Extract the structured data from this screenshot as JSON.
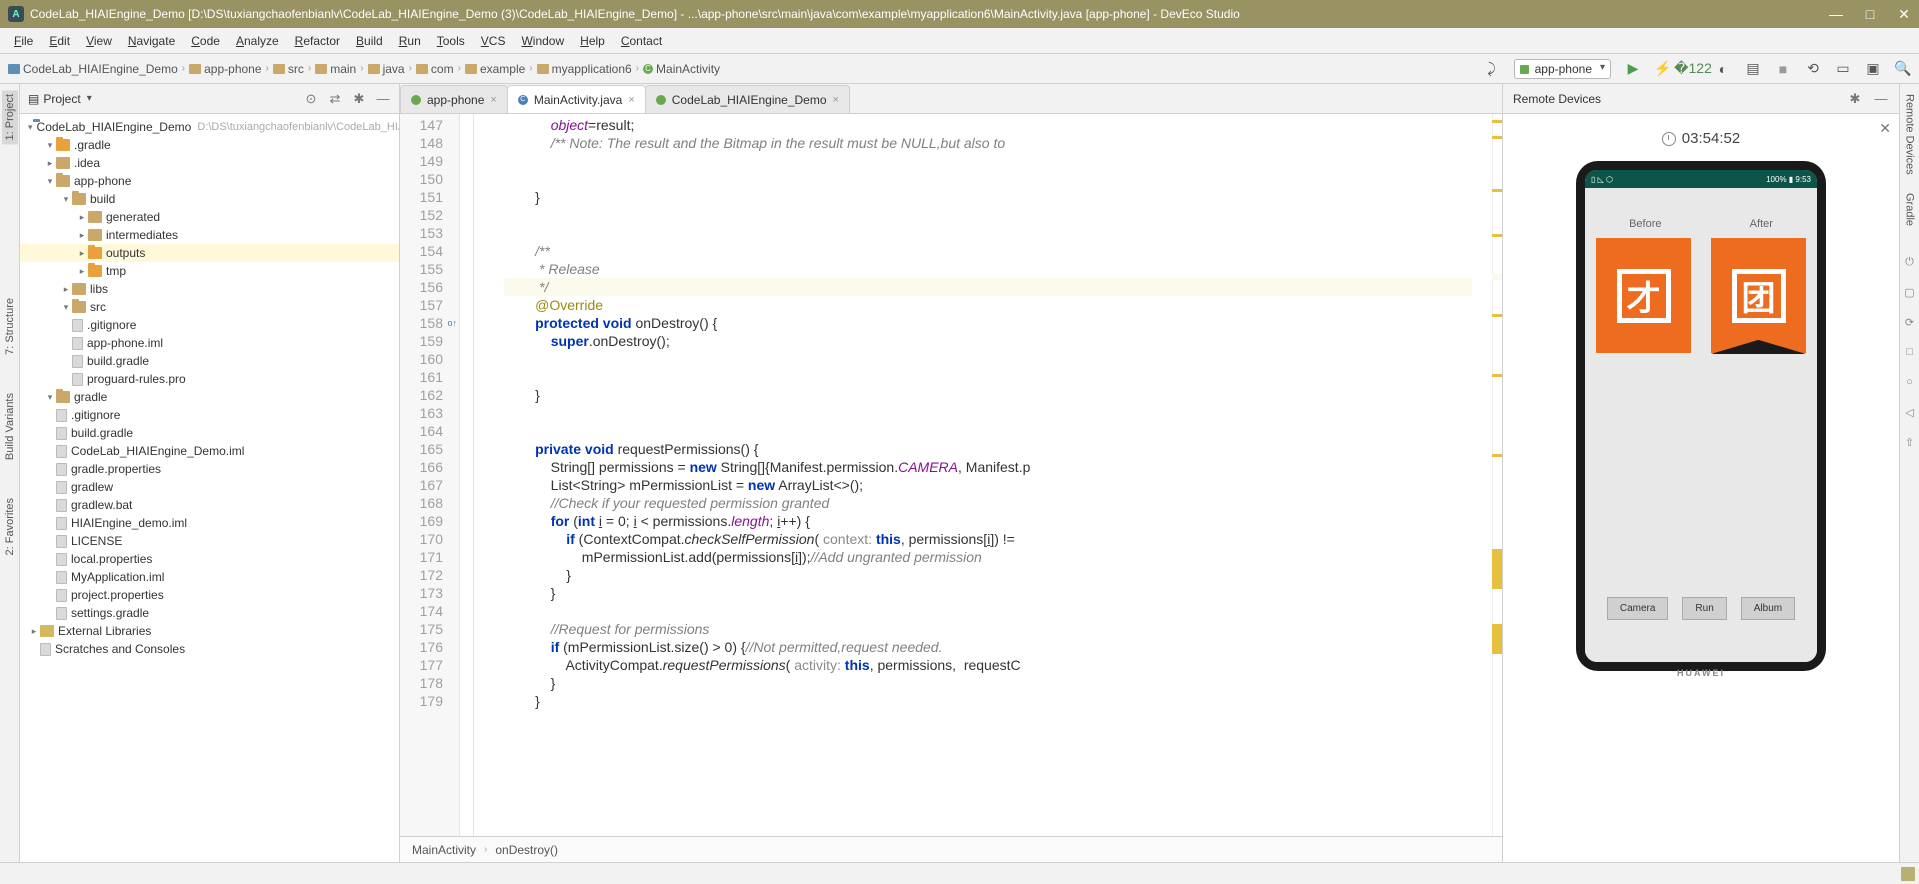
{
  "title": "CodeLab_HIAIEngine_Demo [D:\\DS\\tuxiangchaofenbianlv\\CodeLab_HIAIEngine_Demo (3)\\CodeLab_HIAIEngine_Demo] - ...\\app-phone\\src\\main\\java\\com\\example\\myapplication6\\MainActivity.java [app-phone] - DevEco Studio",
  "menu": [
    "File",
    "Edit",
    "View",
    "Navigate",
    "Code",
    "Analyze",
    "Refactor",
    "Build",
    "Run",
    "Tools",
    "VCS",
    "Window",
    "Help",
    "Contact"
  ],
  "breadcrumbs": [
    "CodeLab_HIAIEngine_Demo",
    "app-phone",
    "src",
    "main",
    "java",
    "com",
    "example",
    "myapplication6",
    "MainActivity"
  ],
  "run_config": "app-phone",
  "panel_title": "Project",
  "project": {
    "root": {
      "label": "CodeLab_HIAIEngine_Demo",
      "path": "D:\\DS\\tuxiangchaofenbianlv\\CodeLab_HIAIEr"
    },
    "items": [
      {
        "d": 1,
        "t": "folder",
        "open": true,
        "hi": true,
        "label": ".gradle"
      },
      {
        "d": 1,
        "t": "folder",
        "label": ".idea"
      },
      {
        "d": 1,
        "t": "folder",
        "open": true,
        "label": "app-phone"
      },
      {
        "d": 2,
        "t": "folder",
        "open": true,
        "label": "build"
      },
      {
        "d": 3,
        "t": "folder",
        "label": "generated"
      },
      {
        "d": 3,
        "t": "folder",
        "label": "intermediates"
      },
      {
        "d": 3,
        "t": "folder",
        "hi": true,
        "label": "outputs",
        "sel": true
      },
      {
        "d": 3,
        "t": "folder",
        "hi": true,
        "label": "tmp"
      },
      {
        "d": 2,
        "t": "folder",
        "label": "libs"
      },
      {
        "d": 2,
        "t": "folder",
        "open": true,
        "label": "src"
      },
      {
        "d": 2,
        "t": "file",
        "label": ".gitignore"
      },
      {
        "d": 2,
        "t": "file",
        "label": "app-phone.iml"
      },
      {
        "d": 2,
        "t": "file",
        "label": "build.gradle"
      },
      {
        "d": 2,
        "t": "file",
        "label": "proguard-rules.pro"
      },
      {
        "d": 1,
        "t": "folder",
        "open": true,
        "label": "gradle"
      },
      {
        "d": 1,
        "t": "file",
        "label": ".gitignore"
      },
      {
        "d": 1,
        "t": "file",
        "label": "build.gradle"
      },
      {
        "d": 1,
        "t": "file",
        "label": "CodeLab_HIAIEngine_Demo.iml"
      },
      {
        "d": 1,
        "t": "file",
        "label": "gradle.properties"
      },
      {
        "d": 1,
        "t": "file",
        "label": "gradlew"
      },
      {
        "d": 1,
        "t": "file",
        "label": "gradlew.bat"
      },
      {
        "d": 1,
        "t": "file",
        "label": "HIAIEngine_demo.iml"
      },
      {
        "d": 1,
        "t": "file",
        "label": "LICENSE"
      },
      {
        "d": 1,
        "t": "file",
        "label": "local.properties"
      },
      {
        "d": 1,
        "t": "file",
        "label": "MyApplication.iml"
      },
      {
        "d": 1,
        "t": "file",
        "label": "project.properties"
      },
      {
        "d": 1,
        "t": "file",
        "label": "settings.gradle"
      }
    ],
    "extlib": "External Libraries",
    "scratches": "Scratches and Consoles"
  },
  "tabs": [
    {
      "label": "app-phone",
      "icon": "mod"
    },
    {
      "label": "MainActivity.java",
      "icon": "cls",
      "active": true
    },
    {
      "label": "CodeLab_HIAIEngine_Demo",
      "icon": "mod"
    }
  ],
  "code_start": 147,
  "code_lines": [
    "            <span class='fld'>object</span>=result;",
    "            <span class='jd'>/** Note: The result and the Bitmap in the result must be NULL,but also to</span>",
    "",
    "",
    "        }",
    "",
    "",
    "        <span class='jd'>/**</span>",
    "<span class='jd'>         * Release</span>",
    "<span class='jd'>         */</span>",
    "        <span class='an'>@Override</span>",
    "        <span class='kw'>protected void</span> onDestroy() {",
    "            <span class='kw'>super</span>.onDestroy();",
    "",
    "",
    "        }",
    "",
    "",
    "        <span class='kw'>private void</span> requestPermissions() {",
    "            String[] permissions = <span class='kw'>new</span> String[]{Manifest.permission.<span class='fld'>CAMERA</span>, Manifest.p",
    "            List&lt;String&gt; mPermissionList = <span class='kw'>new</span> ArrayList&lt;&gt;();",
    "            <span class='cm'>//Check if your requested permission granted</span>",
    "            <span class='kw'>for</span> (<span class='kw'>int</span> <u>i</u> = 0; <u>i</u> &lt; permissions.<span class='fld'>length</span>; <u>i</u>++) {",
    "                <span class='kw'>if</span> (ContextCompat.<span class='fn'>checkSelfPermission</span>( <span class='param'>context:</span> <span class='kw'>this</span>, permissions[<u>i</u>]) !=",
    "                    mPermissionList.add(permissions[<u>i</u>]);<span class='cm'>//Add ungranted permission</span>",
    "                }",
    "            }",
    "",
    "            <span class='cm'>//Request for permissions</span>",
    "            <span class='kw'>if</span> (mPermissionList.size() &gt; 0) {<span class='cm'>//Not permitted,request needed.</span>",
    "                ActivityCompat.<span class='fn'>requestPermissions</span>( <span class='param'>activity:</span> <span class='kw'>this</span>, permissions,  requestC",
    "            }",
    "        }"
  ],
  "caret_line": 156,
  "code_crumbs": [
    "MainActivity",
    "onDestroy()"
  ],
  "remote": {
    "title": "Remote Devices",
    "timer": "03:54:52",
    "status_left": "▯ ◺ ⬡",
    "status_right": "100% ▮ 9:53",
    "before": "Before",
    "after": "After",
    "char1": "才",
    "char2": "团",
    "buttons": [
      "Camera",
      "Run",
      "Album"
    ],
    "brand": "HUAWEI"
  },
  "side_tabs": {
    "project": "1: Project",
    "structure": "7: Structure",
    "buildvar": "Build Variants",
    "fav": "2: Favorites",
    "remote": "Remote Devices",
    "gradle": "Gradle"
  }
}
